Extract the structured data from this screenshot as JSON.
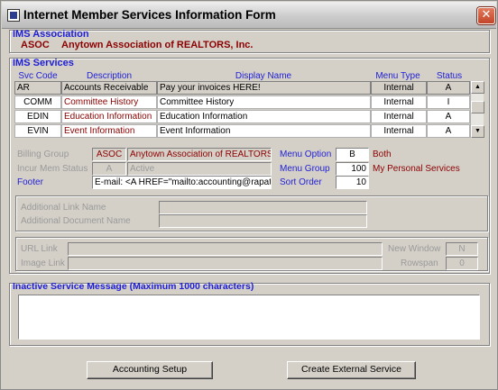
{
  "window": {
    "title": "Internet Member Services Information Form",
    "close_glyph": "✕"
  },
  "association": {
    "header": "IMS Association",
    "code": "ASOC",
    "name": "Anytown Association of REALTORS, Inc."
  },
  "services": {
    "header": "IMS Services",
    "columns": {
      "svc_code": "Svc Code",
      "description": "Description",
      "display_name": "Display Name",
      "menu_type": "Menu Type",
      "status": "Status"
    },
    "rows": [
      {
        "code": "AR",
        "description": "Accounts Receivable",
        "display_name": "Pay your invoices HERE!",
        "menu_type": "Internal",
        "status": "A"
      },
      {
        "code": "COMM",
        "description": "Committee History",
        "display_name": "Committee History",
        "menu_type": "Internal",
        "status": "I"
      },
      {
        "code": "EDIN",
        "description": "Education Information",
        "display_name": "Education Information",
        "menu_type": "Internal",
        "status": "A"
      },
      {
        "code": "EVIN",
        "description": "Event Information",
        "display_name": "Event Information",
        "menu_type": "Internal",
        "status": "A"
      }
    ],
    "scroll_up": "▲",
    "scroll_down": "▼"
  },
  "details": {
    "billing_group_label": "Billing Group",
    "billing_group_code": "ASOC",
    "billing_group_name": "Anytown Association of REALTORS, I",
    "incur_mem_status_label": "Incur Mem Status",
    "incur_mem_status_code": "A",
    "incur_mem_status_name": "Active",
    "footer_label": "Footer",
    "footer_value": "E-mail: <A HREF=\"mailto:accounting@rapatton",
    "menu_option_label": "Menu Option",
    "menu_option_value": "B",
    "menu_option_name": "Both",
    "menu_group_label": "Menu Group",
    "menu_group_value": "100",
    "menu_group_name": "My Personal Services",
    "sort_order_label": "Sort Order",
    "sort_order_value": "10"
  },
  "links": {
    "additional_link_name_label": "Additional Link Name",
    "additional_link_name_value": "",
    "additional_document_name_label": "Additional Document Name",
    "additional_document_name_value": "",
    "url_link_label": "URL Link",
    "url_link_value": "",
    "image_link_label": "Image Link",
    "image_link_value": "",
    "new_window_label": "New Window",
    "new_window_value": "N",
    "rowspan_label": "Rowspan",
    "rowspan_value": "0"
  },
  "inactive": {
    "header": "Inactive Service Message (Maximum 1000 characters)",
    "message": ""
  },
  "buttons": {
    "accounting_setup": "Accounting Setup",
    "create_external_service": "Create External Service"
  },
  "colors": {
    "label_blue": "#1e1ed6",
    "value_dark_red": "#8b0000",
    "disabled_gray": "#9a9a9a",
    "face": "#d4d0c8"
  }
}
